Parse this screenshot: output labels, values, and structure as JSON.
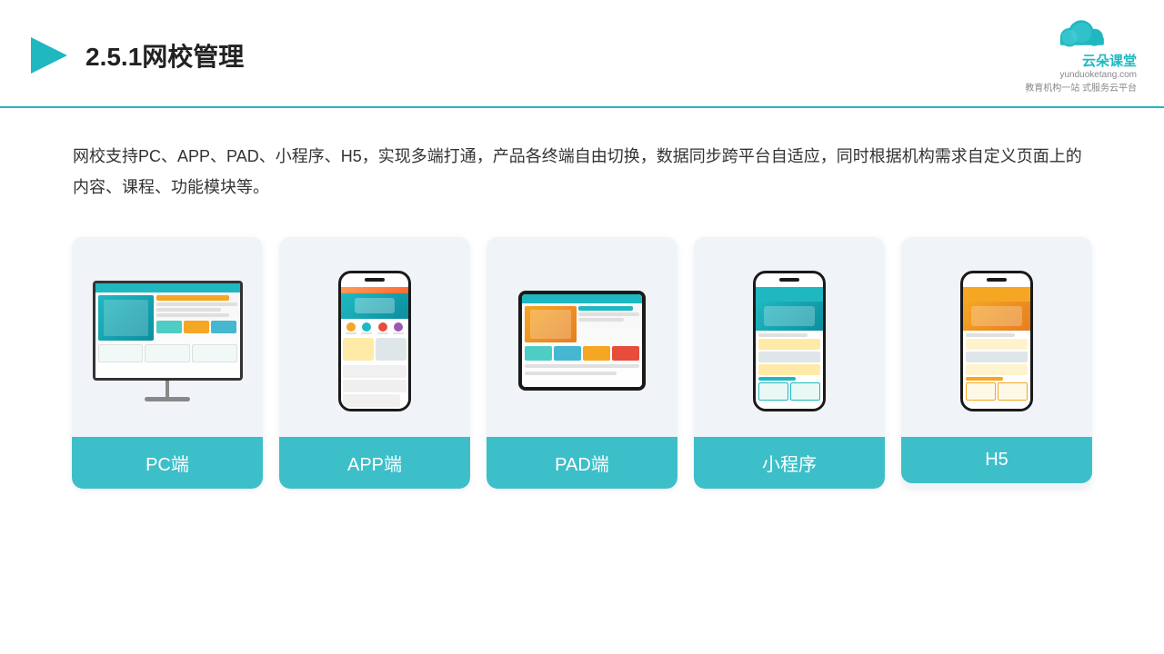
{
  "header": {
    "title": "2.5.1网校管理",
    "logo_name": "云朵课堂",
    "logo_url": "yunduoketang.com",
    "logo_tagline": "教育机构一站",
    "logo_tagline2": "式服务云平台"
  },
  "description": {
    "text": "网校支持PC、APP、PAD、小程序、H5，实现多端打通，产品各终端自由切换，数据同步跨平台自适应，同时根据机构需求自定义页面上的内容、课程、功能模块等。"
  },
  "cards": [
    {
      "id": "pc",
      "label": "PC端"
    },
    {
      "id": "app",
      "label": "APP端"
    },
    {
      "id": "pad",
      "label": "PAD端"
    },
    {
      "id": "mini",
      "label": "小程序"
    },
    {
      "id": "h5",
      "label": "H5"
    }
  ],
  "colors": {
    "teal": "#3dbfc9",
    "accent_orange": "#f5a623",
    "dark": "#1a1a1a",
    "bg_card": "#f0f4f8",
    "header_border": "#1fb8c1"
  }
}
